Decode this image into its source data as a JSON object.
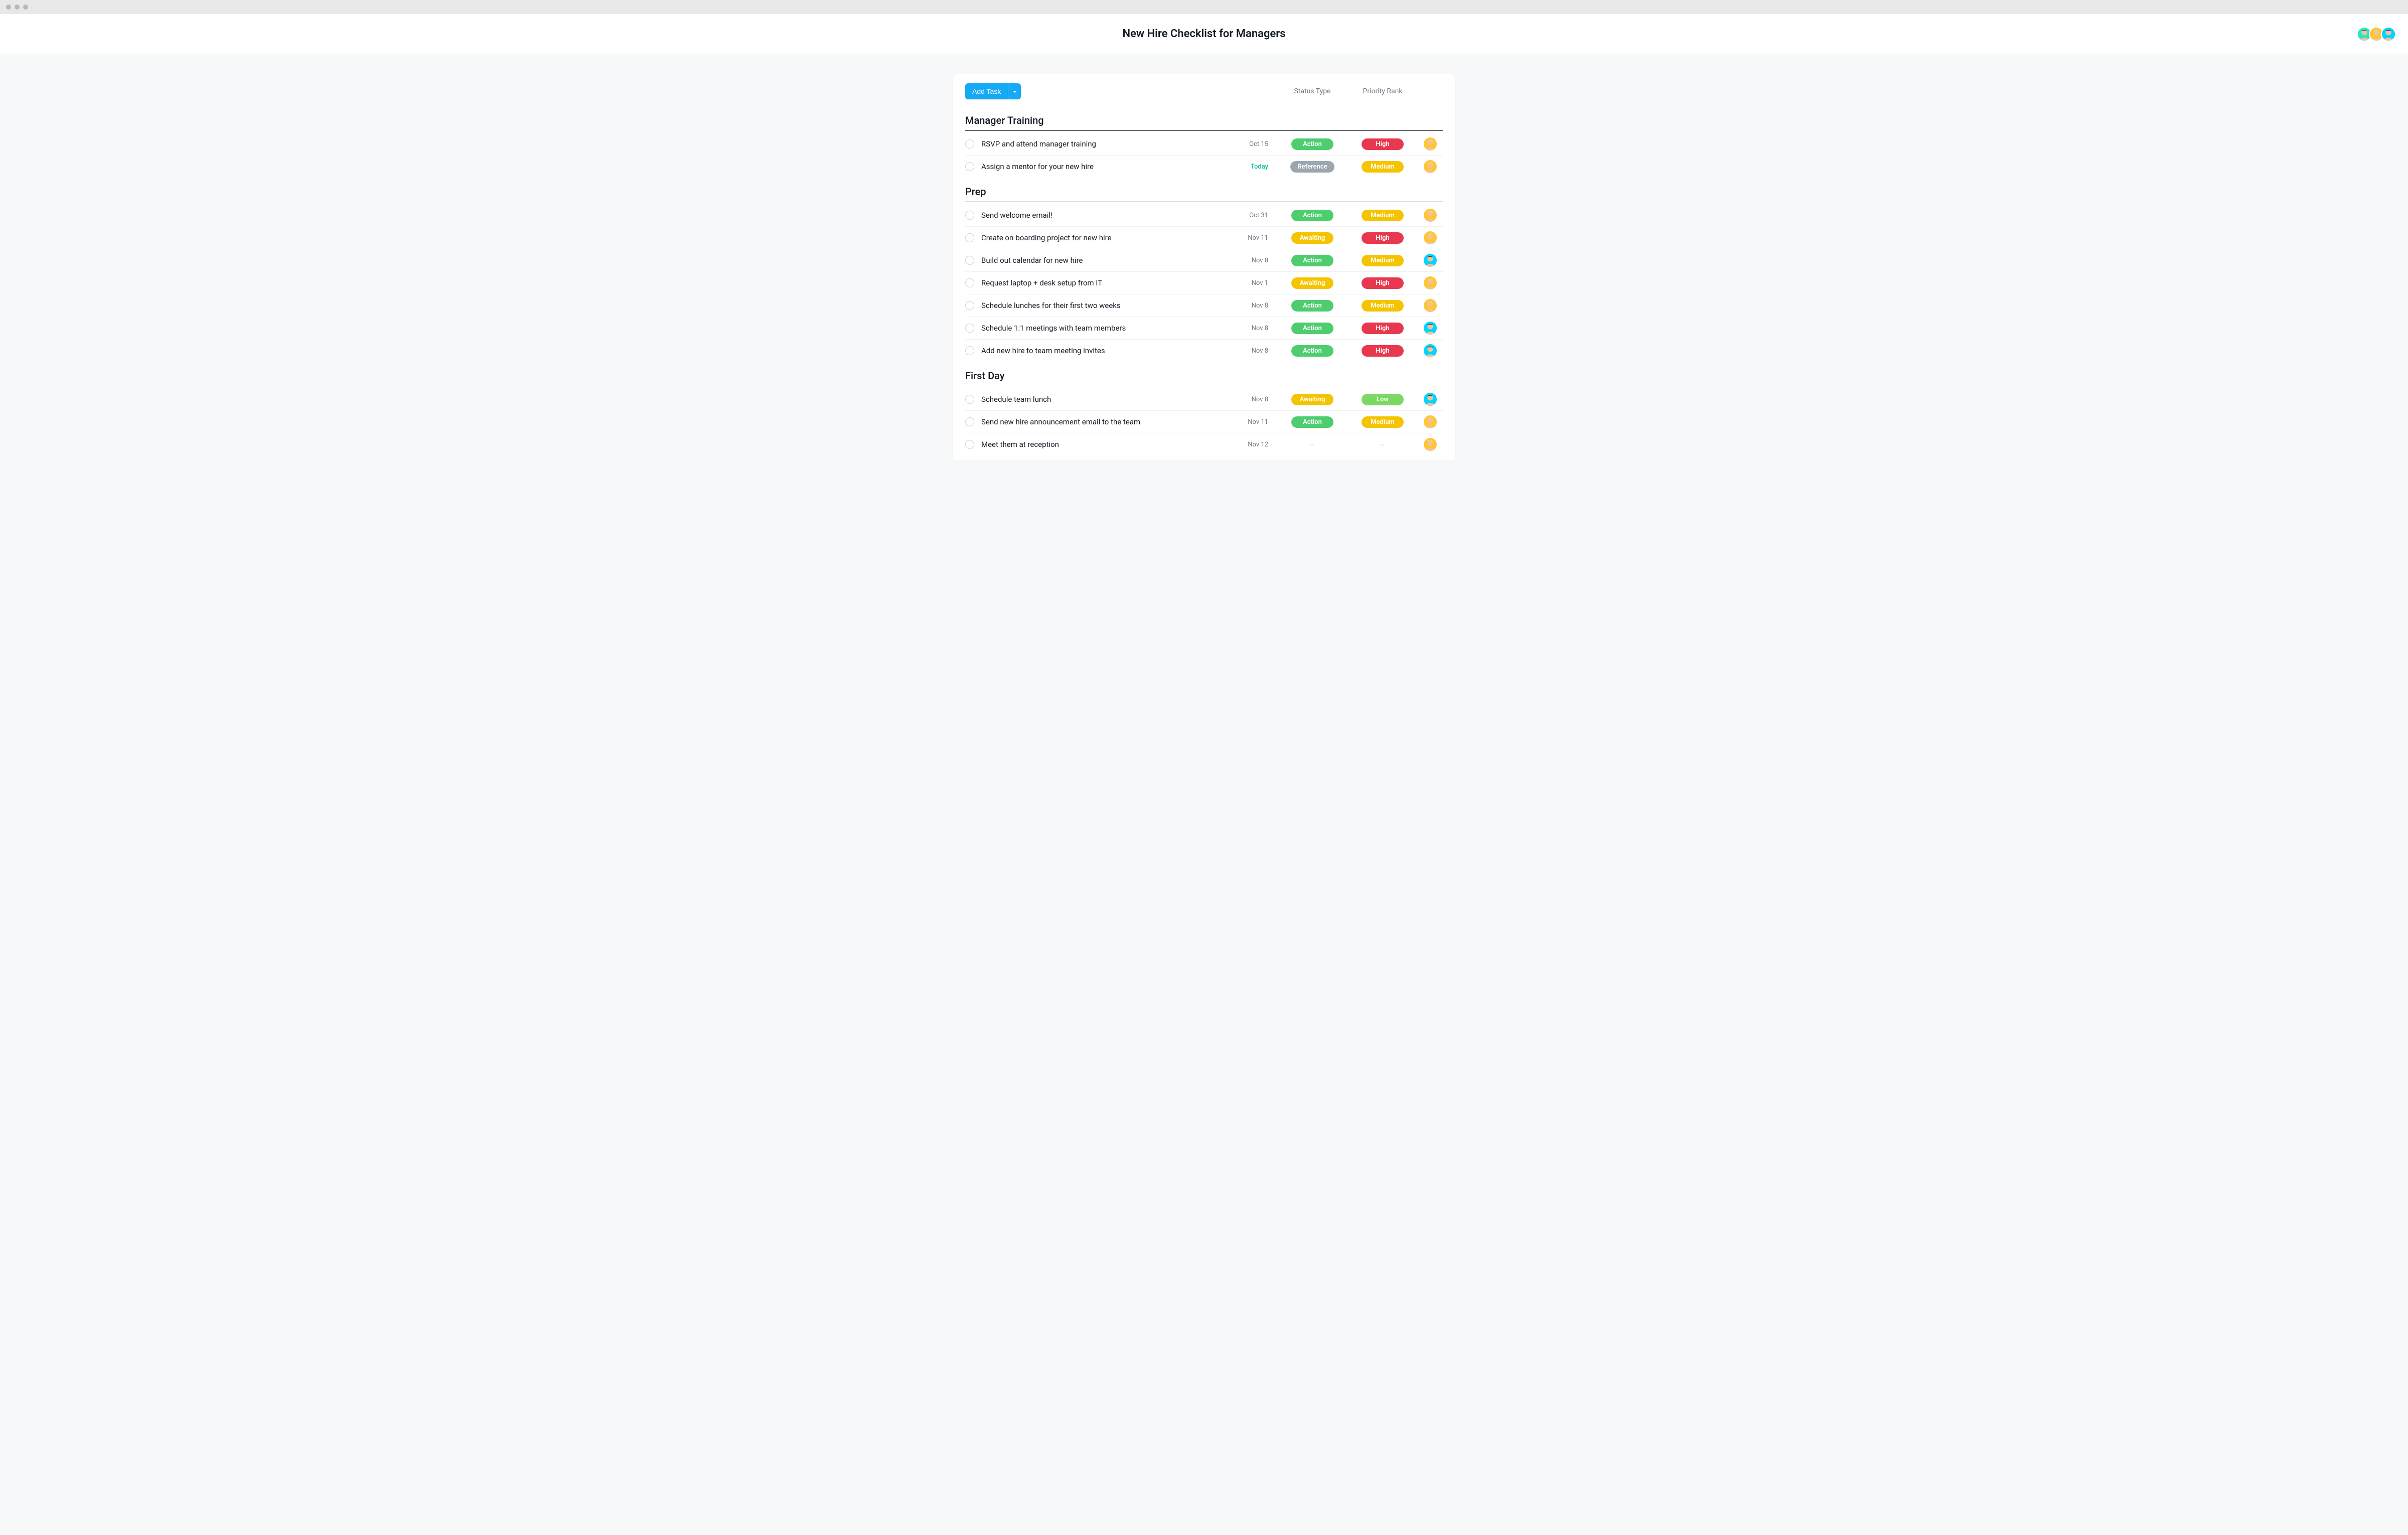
{
  "header": {
    "title": "New Hire Checklist for Managers"
  },
  "toolbar": {
    "add_task_label": "Add Task"
  },
  "columns": {
    "status": "Status Type",
    "priority": "Priority Rank"
  },
  "avatars": [
    {
      "color": "green"
    },
    {
      "color": "yellow"
    },
    {
      "color": "blue"
    }
  ],
  "status_labels": {
    "action": "Action",
    "reference": "Reference",
    "awaiting": "Awaiting"
  },
  "priority_labels": {
    "high": "High",
    "medium": "Medium",
    "low": "Low"
  },
  "sections": [
    {
      "title": "Manager Training",
      "tasks": [
        {
          "name": "RSVP and attend manager training",
          "date": "Oct 15",
          "date_kind": "normal",
          "status": "action",
          "priority": "high",
          "assignee": "yellow"
        },
        {
          "name": "Assign a mentor for your new hire",
          "date": "Today",
          "date_kind": "today",
          "status": "reference",
          "priority": "medium",
          "assignee": "yellow"
        }
      ]
    },
    {
      "title": "Prep",
      "tasks": [
        {
          "name": "Send welcome email!",
          "date": "Oct 31",
          "date_kind": "normal",
          "status": "action",
          "priority": "medium",
          "assignee": "yellow"
        },
        {
          "name": "Create on-boarding project for new hire",
          "date": "Nov 11",
          "date_kind": "normal",
          "status": "awaiting",
          "priority": "high",
          "assignee": "yellow"
        },
        {
          "name": "Build out calendar for new hire",
          "date": "Nov 8",
          "date_kind": "normal",
          "status": "action",
          "priority": "medium",
          "assignee": "blue"
        },
        {
          "name": "Request laptop + desk setup from IT",
          "date": "Nov 1",
          "date_kind": "normal",
          "status": "awaiting",
          "priority": "high",
          "assignee": "yellow"
        },
        {
          "name": "Schedule lunches for their first two weeks",
          "date": "Nov 8",
          "date_kind": "normal",
          "status": "action",
          "priority": "medium",
          "assignee": "yellow"
        },
        {
          "name": "Schedule 1:1 meetings with team members",
          "date": "Nov 8",
          "date_kind": "normal",
          "status": "action",
          "priority": "high",
          "assignee": "blue"
        },
        {
          "name": "Add new hire to team meeting invites",
          "date": "Nov 8",
          "date_kind": "normal",
          "status": "action",
          "priority": "high",
          "assignee": "blue"
        }
      ]
    },
    {
      "title": "First Day",
      "tasks": [
        {
          "name": "Schedule team lunch",
          "date": "Nov 8",
          "date_kind": "normal",
          "status": "awaiting",
          "priority": "low",
          "assignee": "blue"
        },
        {
          "name": "Send new hire announcement email to the team",
          "date": "Nov 11",
          "date_kind": "normal",
          "status": "action",
          "priority": "medium",
          "assignee": "yellow"
        },
        {
          "name": "Meet them at reception",
          "date": "Nov 12",
          "date_kind": "normal",
          "status": null,
          "priority": null,
          "assignee": "yellow"
        }
      ]
    }
  ]
}
